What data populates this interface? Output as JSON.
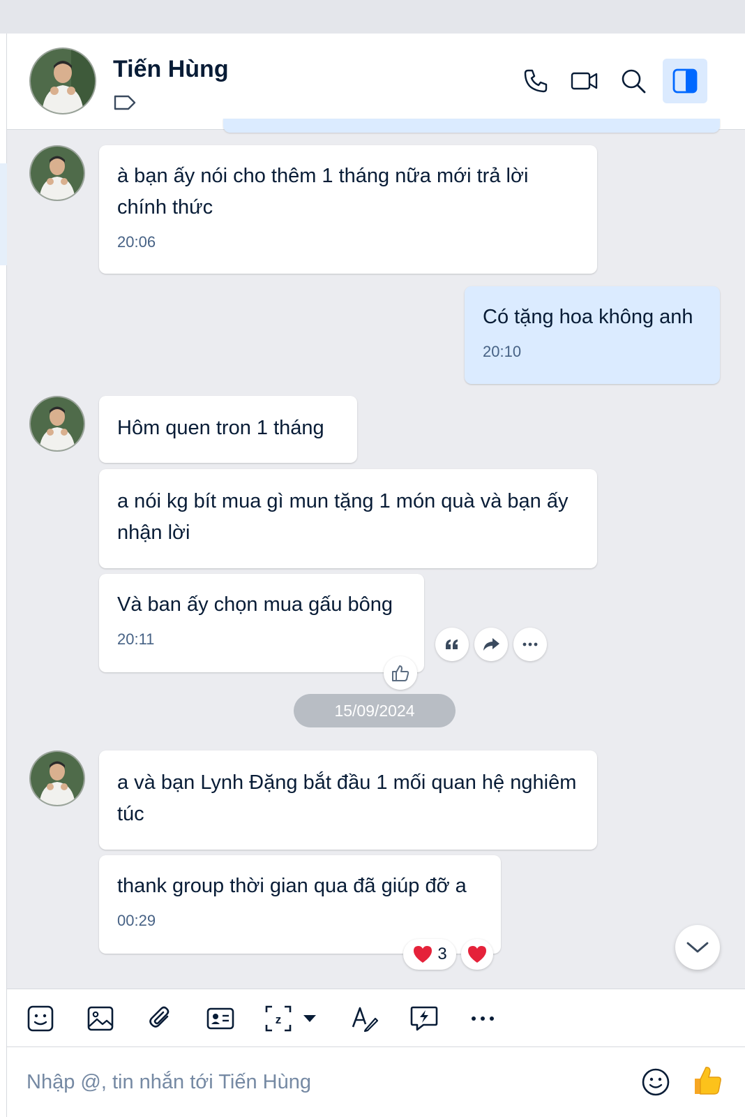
{
  "chat": {
    "contact_name": "Tiến Hùng",
    "header_icons": [
      "tag-icon",
      "phone-icon",
      "video-call-icon",
      "search-icon",
      "toggle-sidebar-icon"
    ]
  },
  "messages": [
    {
      "text": "à bạn ấy nói cho thêm 1 tháng nữa mới trả lời chính thức",
      "time": "20:06",
      "sender": "contact"
    },
    {
      "text": "Có tặng hoa không anh",
      "time": "20:10",
      "sender": "me"
    },
    {
      "text": "Hôm quen tron 1 tháng",
      "sender": "contact"
    },
    {
      "text": "a nói kg bít mua gì mun tặng 1 món quà và bạn ấy nhận lời",
      "sender": "contact"
    },
    {
      "text": "Và ban ấy chọn mua gấu bông",
      "time": "20:11",
      "sender": "contact"
    },
    {
      "text": "a và bạn Lynh Đặng bắt đầu 1 mối quan hệ nghiêm túc",
      "sender": "contact"
    },
    {
      "text": "thank group thời gian qua đã giúp đỡ a",
      "time": "00:29",
      "sender": "contact"
    }
  ],
  "date_separator": "15/09/2024",
  "reactions": {
    "heart_count": "3"
  },
  "message_actions": [
    "quote-icon",
    "forward-icon",
    "more-icon"
  ],
  "toolbar": [
    "sticker-icon",
    "image-icon",
    "attachment-icon",
    "contact-card-icon",
    "screenshot-icon",
    "text-format-icon",
    "quick-message-icon",
    "more-icon"
  ],
  "composer": {
    "placeholder": "Nhập @, tin nhắn tới Tiến Hùng"
  },
  "colors": {
    "accent": "#0068ff",
    "my_bubble": "#dbebff",
    "background": "#ebecf0"
  }
}
